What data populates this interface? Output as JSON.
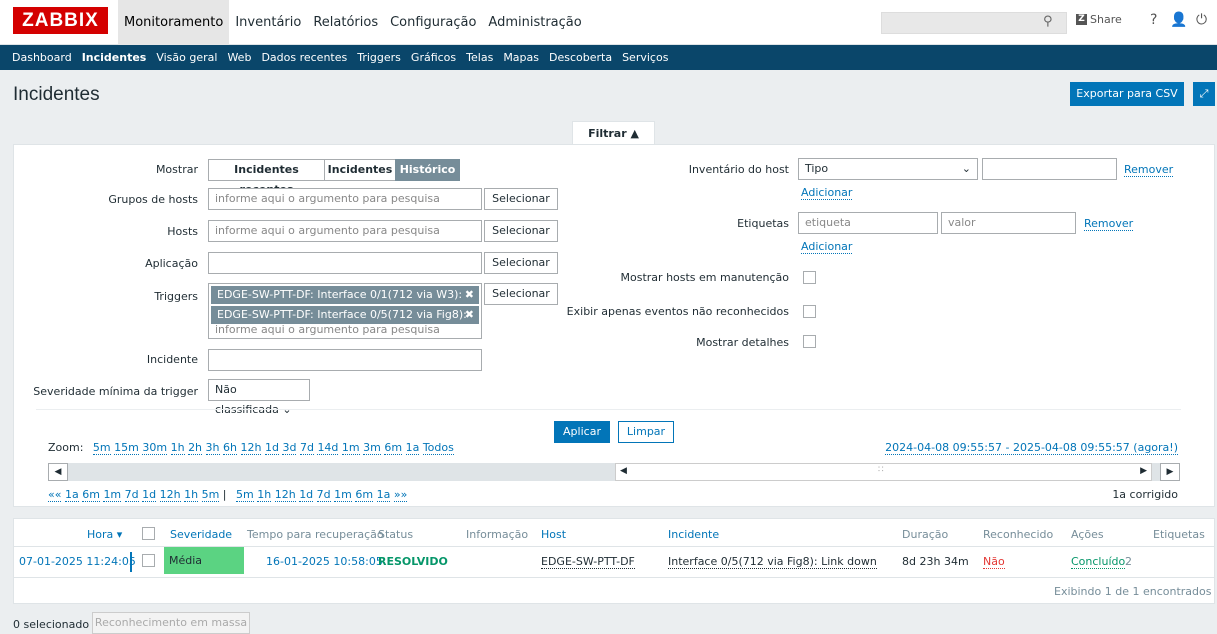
{
  "logo": "ZABBIX",
  "main_menu": [
    "Monitoramento",
    "Inventário",
    "Relatórios",
    "Configuração",
    "Administração"
  ],
  "top_share": "Share",
  "top_help": "?",
  "sub_menu": [
    "Dashboard",
    "Incidentes",
    "Visão geral",
    "Web",
    "Dados recentes",
    "Triggers",
    "Gráficos",
    "Telas",
    "Mapas",
    "Descoberta",
    "Serviços"
  ],
  "page_title": "Incidentes",
  "export_label": "Exportar para CSV",
  "filter_tab": "Filtrar ▲",
  "filter": {
    "show_label": "Mostrar",
    "show_options": [
      "Incidentes recentes",
      "Incidentes",
      "Histórico"
    ],
    "hostgroups_label": "Grupos de hosts",
    "hosts_label": "Hosts",
    "application_label": "Aplicação",
    "triggers_label": "Triggers",
    "incident_label": "Incidente",
    "severity_label": "Severidade mínima da trigger",
    "severity_value": "Não classificada",
    "placeholder": "informe aqui o argumento para pesquisa",
    "select_label": "Selecionar",
    "trigger_chips": [
      "EDGE-SW-PTT-DF: Interface 0/1(712 via W3): L...",
      "EDGE-SW-PTT-DF: Interface 0/5(712 via Fig8): ..."
    ],
    "inventory_label": "Inventário do host",
    "inventory_type": "Tipo",
    "remove_label": "Remover",
    "add_label": "Adicionar",
    "tags_label": "Etiquetas",
    "tag_placeholder": "etiqueta",
    "value_placeholder": "valor",
    "maint_label": "Mostrar hosts em manutenção",
    "unack_label": "Exibir apenas eventos não reconhecidos",
    "details_label": "Mostrar detalhes",
    "apply_label": "Aplicar",
    "clear_label": "Limpar"
  },
  "zoom": {
    "prefix": "Zoom:",
    "items": [
      "5m",
      "15m",
      "30m",
      "1h",
      "2h",
      "3h",
      "6h",
      "12h",
      "1d",
      "3d",
      "7d",
      "14d",
      "1m",
      "3m",
      "6m",
      "1a",
      "Todos"
    ],
    "range": "2024-04-08 09:55:57 - 2025-04-08 09:55:57 (agora!)",
    "nav": [
      "««",
      "1a",
      "6m",
      "1m",
      "7d",
      "1d",
      "12h",
      "1h",
      "5m",
      "|",
      "5m",
      "1h",
      "12h",
      "1d",
      "7d",
      "1m",
      "6m",
      "1a",
      "»»"
    ],
    "fixed": "1a  corrigido"
  },
  "table": {
    "headers": {
      "time": "Hora ▾",
      "severity": "Severidade",
      "recovery": "Tempo para recuperação",
      "status": "Status",
      "info": "Informação",
      "host": "Host",
      "problem": "Incidente",
      "duration": "Duração",
      "ack": "Reconhecido",
      "actions": "Ações",
      "tags": "Etiquetas"
    },
    "row": {
      "time": "07-01-2025 11:24:05",
      "severity": "Média",
      "recovery": "16-01-2025 10:58:05",
      "status": "RESOLVIDO",
      "host": "EDGE-SW-PTT-DF",
      "problem": "Interface 0/5(712 via Fig8): Link down",
      "duration": "8d 23h 34m",
      "ack": "Não",
      "actions": "Concluído",
      "actions_count": "2"
    },
    "footer": "Exibindo 1 de 1 encontrados"
  },
  "bottom": {
    "selected": "0 selecionado",
    "mass": "Reconhecimento em massa"
  },
  "colors": {
    "brand": "#d40000",
    "nav": "#0a466a",
    "accent": "#0275b8",
    "severity_average": "#5bd382",
    "resolved": "#059669",
    "ack_no": "#e33734"
  }
}
